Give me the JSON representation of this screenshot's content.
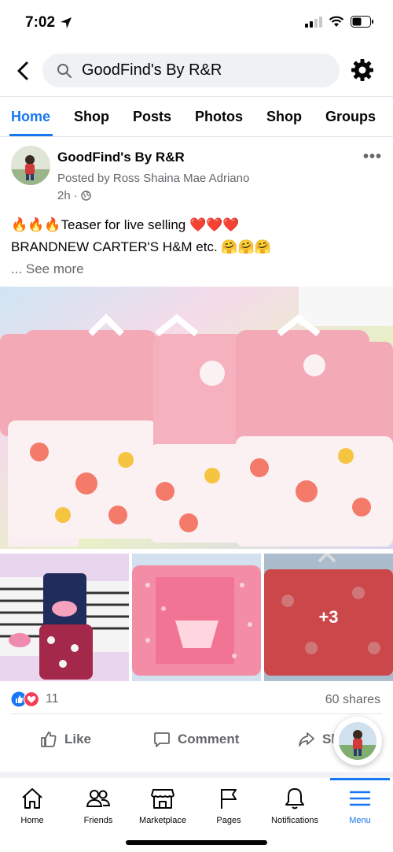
{
  "status": {
    "time": "7:02"
  },
  "search": {
    "query": "GoodFind's By R&R"
  },
  "tabs": [
    "Home",
    "Shop",
    "Posts",
    "Photos",
    "Shop",
    "Groups"
  ],
  "post": {
    "page_name": "GoodFind's By R&R",
    "posted_by": "Posted by Ross Shaina Mae Adriano",
    "time": "2h ·",
    "line1": "🔥🔥🔥Teaser for live selling ❤️❤️❤️",
    "line2": "BRANDNEW CARTER'S  H&M etc. 🤗🤗🤗",
    "see_more": "... See more",
    "extra_photos": "+3",
    "reaction_count": "11",
    "shares": "60 shares"
  },
  "actions": {
    "like": "Like",
    "comment": "Comment",
    "share": "Sh"
  },
  "bottom_nav": [
    {
      "label": "Home",
      "icon": "home-icon"
    },
    {
      "label": "Friends",
      "icon": "friends-icon"
    },
    {
      "label": "Marketplace",
      "icon": "marketplace-icon"
    },
    {
      "label": "Pages",
      "icon": "pages-flag-icon"
    },
    {
      "label": "Notifications",
      "icon": "bell-icon"
    },
    {
      "label": "Menu",
      "icon": "menu-icon",
      "active": true
    }
  ],
  "colors": {
    "accent": "#1877f2",
    "muted": "#65676b",
    "like_blue": "#1877f2",
    "love_red": "#f33e58"
  }
}
